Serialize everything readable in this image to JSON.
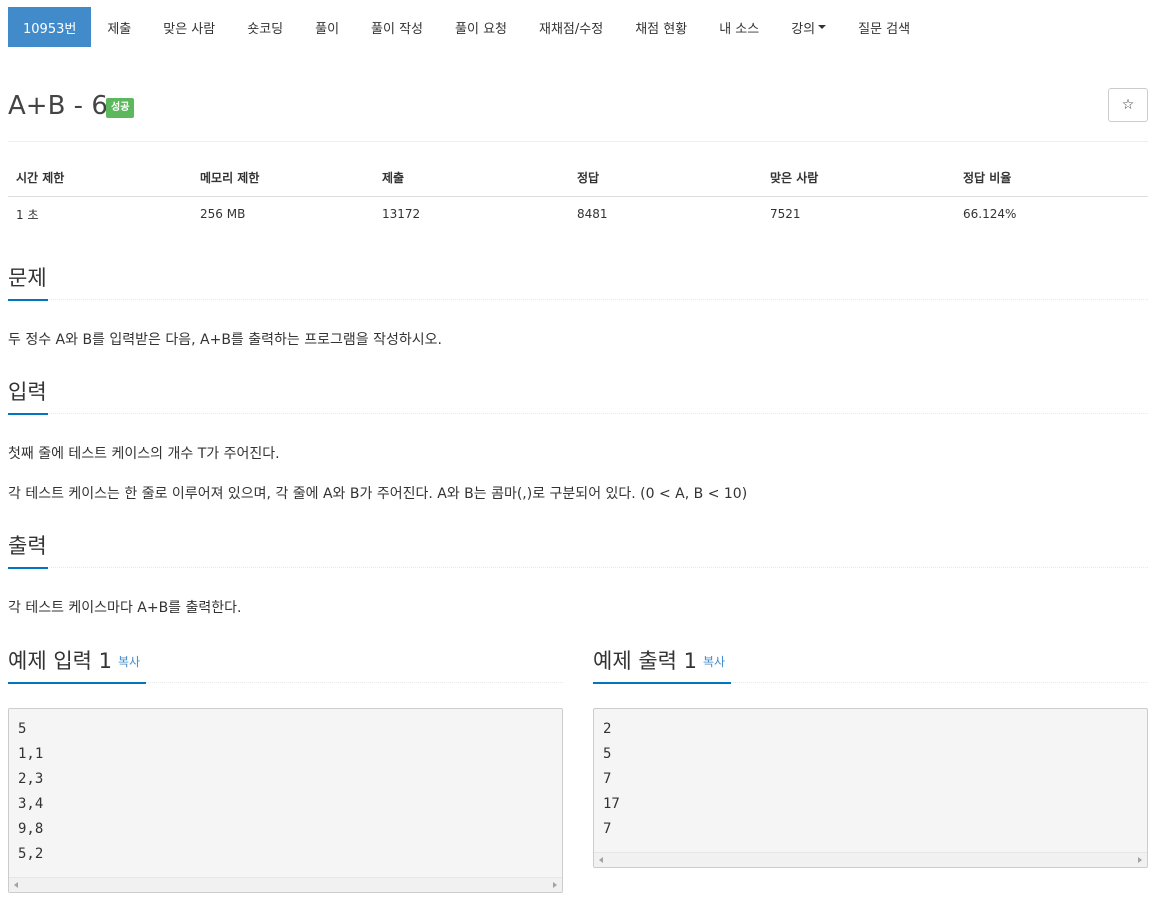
{
  "nav": {
    "items": [
      {
        "label": "10953번",
        "active": true
      },
      {
        "label": "제출"
      },
      {
        "label": "맞은 사람"
      },
      {
        "label": "숏코딩"
      },
      {
        "label": "풀이"
      },
      {
        "label": "풀이 작성"
      },
      {
        "label": "풀이 요청"
      },
      {
        "label": "재채점/수정"
      },
      {
        "label": "채점 현황"
      },
      {
        "label": "내 소스"
      },
      {
        "label": "강의"
      },
      {
        "label": "질문 검색"
      }
    ]
  },
  "problem": {
    "title": "A+B - 6",
    "badge": "성공",
    "badge_color": "#5cb85c",
    "star_icon": "☆"
  },
  "info_table": {
    "headers": [
      "시간 제한",
      "메모리 제한",
      "제출",
      "정답",
      "맞은 사람",
      "정답 비율"
    ],
    "values": [
      "1 초",
      "256 MB",
      "13172",
      "8481",
      "7521",
      "66.124%"
    ]
  },
  "sections": {
    "problem_heading": "문제",
    "problem_text": "두 정수 A와 B를 입력받은 다음, A+B를 출력하는 프로그램을 작성하시오.",
    "input_heading": "입력",
    "input_text_1": "첫째 줄에 테스트 케이스의 개수 T가 주어진다.",
    "input_text_2": "각 테스트 케이스는 한 줄로 이루어져 있으며, 각 줄에 A와 B가 주어진다. A와 B는 콤마(,)로 구분되어 있다. (0 < A, B < 10)",
    "output_heading": "출력",
    "output_text": "각 테스트 케이스마다 A+B를 출력한다."
  },
  "samples": {
    "input_heading": "예제 입력 1",
    "output_heading": "예제 출력 1",
    "copy_label": "복사",
    "input_data": "5\n1,1\n2,3\n3,4\n9,8\n5,2",
    "output_data": "2\n5\n7\n17\n7"
  },
  "colors": {
    "nav_active": "#428bca",
    "accent_underline": "#0076c0",
    "link": "#428bca"
  }
}
